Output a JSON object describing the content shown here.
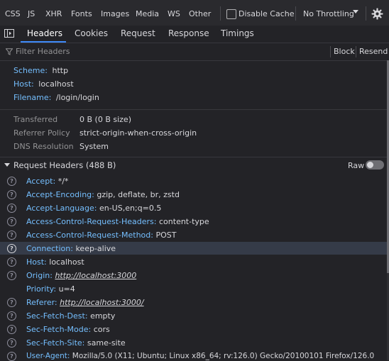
{
  "type_filters": [
    "CSS",
    "JS",
    "XHR",
    "Fonts",
    "Images",
    "Media",
    "WS",
    "Other"
  ],
  "disable_cache_label": "Disable Cache",
  "throttling_value": "No Throttling",
  "tabs": [
    "Headers",
    "Cookies",
    "Request",
    "Response",
    "Timings"
  ],
  "filter_placeholder": "Filter Headers",
  "block_label": "Block",
  "resend_label": "Resend",
  "url_info": [
    {
      "key": "Scheme:",
      "value": "http"
    },
    {
      "key": "Host:",
      "value": "localhost"
    },
    {
      "key": "Filename:",
      "value": "/login/login"
    }
  ],
  "summary": [
    {
      "label": "Transferred",
      "value": "0 B (0 B size)"
    },
    {
      "label": "Referrer Policy",
      "value": "strict-origin-when-cross-origin"
    },
    {
      "label": "DNS Resolution",
      "value": "System"
    }
  ],
  "request_headers_title": "Request Headers (488 B)",
  "raw_label": "Raw",
  "raw_enabled": false,
  "request_headers": [
    {
      "name": "Accept:",
      "value": "*/*"
    },
    {
      "name": "Accept-Encoding:",
      "value": "gzip, deflate, br, zstd"
    },
    {
      "name": "Accept-Language:",
      "value": "en-US,en;q=0.5"
    },
    {
      "name": "Access-Control-Request-Headers:",
      "value": "content-type"
    },
    {
      "name": "Access-Control-Request-Method:",
      "value": "POST"
    },
    {
      "name": "Connection:",
      "value": "keep-alive"
    },
    {
      "name": "Host:",
      "value": "localhost"
    },
    {
      "name": "Origin:",
      "value": "http://localhost:3000"
    },
    {
      "name": "Priority:",
      "value": "u=4"
    },
    {
      "name": "Referer:",
      "value": "http://localhost:3000/"
    },
    {
      "name": "Sec-Fetch-Dest:",
      "value": "empty"
    },
    {
      "name": "Sec-Fetch-Mode:",
      "value": "cors"
    },
    {
      "name": "Sec-Fetch-Site:",
      "value": "same-site"
    },
    {
      "name": "User-Agent:",
      "value": "Mozilla/5.0 (X11; Ubuntu; Linux x86_64; rv:126.0) Gecko/20100101 Firefox/126.0"
    }
  ],
  "help_glyph": "?",
  "colors": {
    "accent": "#3f8af8",
    "header_key": "#75bfff",
    "highlight_row": "#353b48"
  }
}
